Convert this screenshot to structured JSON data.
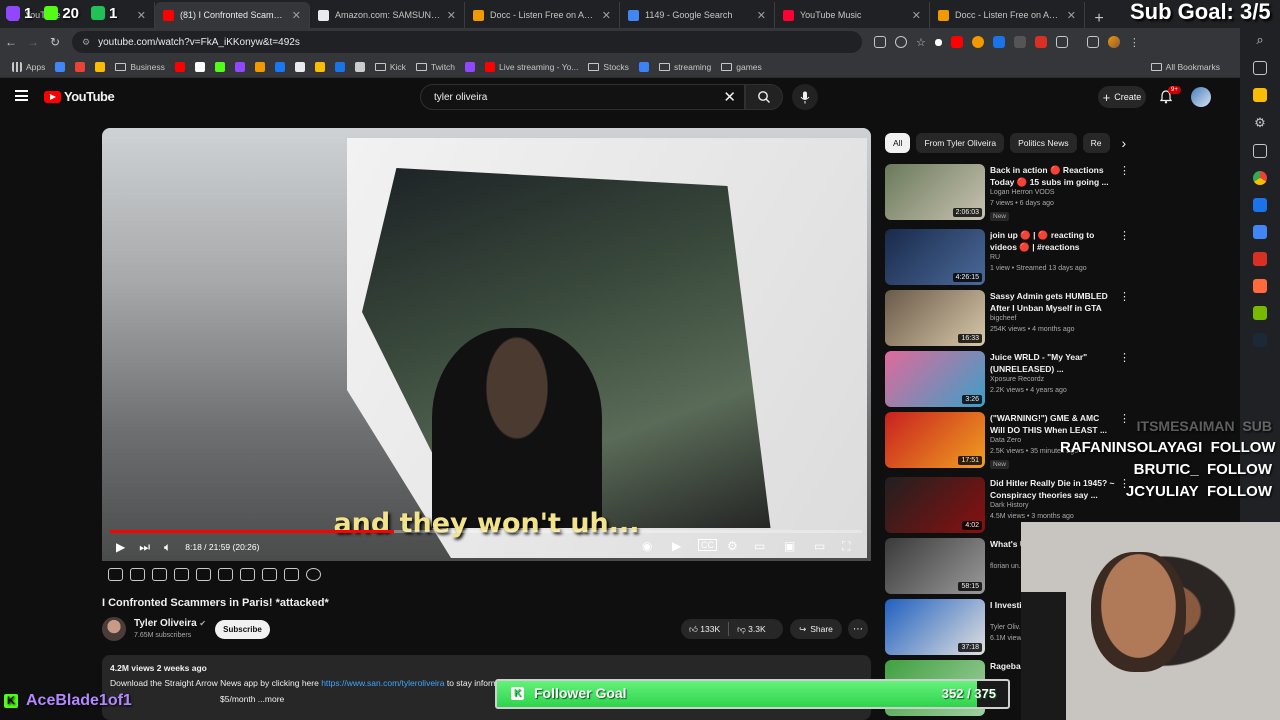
{
  "browser": {
    "tabs": [
      {
        "label": "YouTube",
        "color": "#9146ff",
        "active": false
      },
      {
        "label": "(81) I Confronted Scammers in Paris",
        "color": "#ff0000",
        "active": true
      },
      {
        "label": "Amazon.com: SAMSUNG Gala",
        "color": "#e8eaed",
        "active": false
      },
      {
        "label": "Docc - Listen Free on Audiom",
        "color": "#f29900",
        "active": false
      },
      {
        "label": "1149 - Google Search",
        "color": "#4285f4",
        "active": false
      },
      {
        "label": "YouTube Music",
        "color": "#ff0033",
        "active": false
      },
      {
        "label": "Docc - Listen Free on Audiom",
        "color": "#f29900",
        "active": false
      }
    ],
    "url": "youtube.com/watch?v=FkA_iKKonyw&t=492s",
    "bookmarks": [
      {
        "label": "Apps",
        "type": "grid"
      },
      {
        "label": "",
        "type": "icon",
        "color": "#4285f4"
      },
      {
        "label": "",
        "type": "icon",
        "color": "#ea4335"
      },
      {
        "label": "",
        "type": "icon",
        "color": "#fbbc04"
      },
      {
        "label": "Business",
        "type": "folder"
      },
      {
        "label": "",
        "type": "icon",
        "color": "#ff0000"
      },
      {
        "label": "",
        "type": "icon",
        "color": "#ffffff"
      },
      {
        "label": "",
        "type": "icon",
        "color": "#53fc18"
      },
      {
        "label": "",
        "type": "icon",
        "color": "#9146ff"
      },
      {
        "label": "",
        "type": "icon",
        "color": "#f29900"
      },
      {
        "label": "",
        "type": "icon",
        "color": "#1877f2"
      },
      {
        "label": "",
        "type": "icon",
        "color": "#e8eaed"
      },
      {
        "label": "",
        "type": "icon",
        "color": "#fbbc04"
      },
      {
        "label": "",
        "type": "icon",
        "color": "#1a73e8"
      },
      {
        "label": "",
        "type": "icon",
        "color": "#cccccc"
      },
      {
        "label": "Kick",
        "type": "folder"
      },
      {
        "label": "Twitch",
        "type": "folder"
      },
      {
        "label": "",
        "type": "icon",
        "color": "#9146ff"
      },
      {
        "label": "Live streaming - Yo...",
        "type": "icon",
        "color": "#ff0000"
      },
      {
        "label": "Stocks",
        "type": "folder"
      },
      {
        "label": "",
        "type": "icon",
        "color": "#3b82f6"
      },
      {
        "label": "streaming",
        "type": "folder"
      },
      {
        "label": "games",
        "type": "folder"
      }
    ],
    "all_bookmarks": "All Bookmarks"
  },
  "youtube": {
    "logo": "YouTube",
    "search_value": "tyler oliveira",
    "create_label": "Create",
    "notif_count": "9+",
    "video": {
      "caption": "and they won't uh...",
      "time": "8:18 / 21:59 (20:26)",
      "progress": 0.378,
      "title": "I Confronted Scammers in Paris! *attacked*",
      "channel": "Tyler Oliveira",
      "subscribers": "7.65M subscribers",
      "subscribe_label": "Subscribe",
      "likes": "133K",
      "dislikes": "3.3K",
      "share_label": "Share",
      "description": {
        "meta": "4.2M views  2 weeks ago",
        "text": "Download the Straight Arrow News app by clicking here ",
        "link": "https://www.san.com/tyleroliveira",
        "text2": " to stay inform...",
        "more": "...more"
      }
    },
    "chips": [
      "All",
      "From Tyler Oliveira",
      "Politics News",
      "Re"
    ],
    "recommendations": [
      {
        "title": "Back in action 🔴 Reactions Today 🔴 15 subs im going ...",
        "channel": "Logan Herron VODS",
        "views": "7 views • 6 days ago",
        "duration": "2:06:03",
        "badge": "New",
        "colors": [
          "#6a7a5a",
          "#c9c2b2"
        ]
      },
      {
        "title": "join up 🔴 | 🔴 reacting to videos 🔴 | #reactions",
        "channel": "RU",
        "views": "1 view • Streamed 13 days ago",
        "duration": "4:26:15",
        "badge": "",
        "colors": [
          "#1a2a4a",
          "#4a6a9a"
        ]
      },
      {
        "title": "Sassy Admin gets HUMBLED After I Unban Myself in GTA RP",
        "channel": "bigcheef",
        "views": "254K views • 4 months ago",
        "duration": "16:33",
        "badge": "",
        "colors": [
          "#6a5a4a",
          "#d8c8a8"
        ]
      },
      {
        "title": "Juice WRLD - \"My Year\" (UNRELEASED) ...",
        "channel": "Xposure Recordz",
        "views": "2.2K views • 4 years ago",
        "duration": "3:26",
        "badge": "",
        "colors": [
          "#e06a9a",
          "#3aa0c8"
        ]
      },
      {
        "title": "(\"WARNING!\") GME & AMC Will DO THIS When LEAST ...",
        "channel": "Data Zero",
        "views": "2.5K views • 35 minutes ago",
        "duration": "17:51",
        "badge": "New",
        "colors": [
          "#c82020",
          "#f0a020"
        ]
      },
      {
        "title": "Did Hitler Really Die in 1945? ~ Conspiracy theories say ...",
        "channel": "Dark History",
        "views": "4.5M views • 3 months ago",
        "duration": "4:02",
        "badge": "",
        "colors": [
          "#202020",
          "#8a1010"
        ]
      },
      {
        "title": "What's Up Undergr...",
        "channel": "florian un...",
        "views": "",
        "duration": "58:15",
        "badge": "",
        "colors": [
          "#3a3a3a",
          "#9a9a9a"
        ]
      },
      {
        "title": "I Investi... You Can...",
        "channel": "Tyler Oliv...",
        "views": "6.1M view...",
        "duration": "37:18",
        "badge": "",
        "colors": [
          "#2060c0",
          "#e0e0e0"
        ]
      },
      {
        "title": "Ragebai...",
        "channel": "",
        "views": "",
        "duration": "",
        "badge": "",
        "colors": [
          "#40a040",
          "#a0d0a0"
        ]
      }
    ]
  },
  "overlay": {
    "sub_goal": "Sub Goal: 3/5",
    "counters": [
      "1",
      "20",
      "1"
    ],
    "alerts": [
      {
        "name": "ITSMESAIMAN",
        "action": "SUB",
        "faded": true
      },
      {
        "name": "RAFANINSOLAYAGI",
        "action": "FOLLOW",
        "faded": false
      },
      {
        "name": "BRUTIC_",
        "action": "FOLLOW",
        "faded": false
      },
      {
        "name": "JCYULIAY",
        "action": "FOLLOW",
        "faded": false
      }
    ],
    "follower_goal": {
      "label": "Follower Goal",
      "current": 352,
      "target": 375,
      "count_text": "352 / 375"
    },
    "kick_user": "AceBlade1of1",
    "kick_msg": "$5/month  ...more"
  }
}
